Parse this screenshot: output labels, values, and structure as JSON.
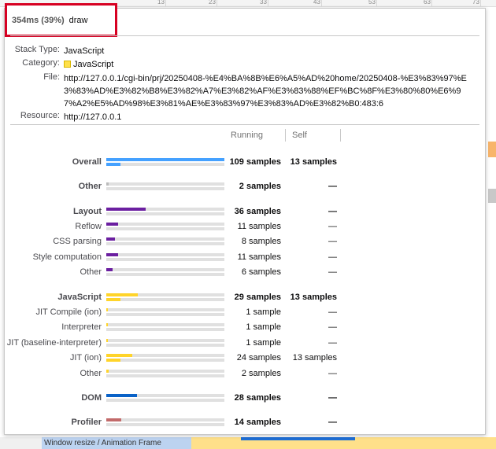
{
  "background": {
    "ticks": [
      "13",
      "23",
      "33",
      "43",
      "53",
      "63",
      "73"
    ],
    "bottom_track_label": "Window resize / Animation Frame"
  },
  "tooltip": {
    "duration": "354ms (39%)",
    "function_name": "draw",
    "details": {
      "stack_type_label": "Stack Type:",
      "stack_type": "JavaScript",
      "category_label": "Category:",
      "category": "JavaScript",
      "category_color": "#ffe04a",
      "file_label": "File:",
      "file": "http://127.0.0.1/cgi-bin/prj/20250408-%E4%BA%8B%E6%A5%AD%20home/20250408-%E3%83%97%E3%83%AD%E3%82%B8%E3%82%A7%E3%82%AF%E3%83%88%EF%BC%8F%E3%80%80%E6%97%A2%E5%AD%98%E3%81%AE%E3%83%97%E3%83%AD%E3%82%B0:483:6",
      "resource_label": "Resource:",
      "resource": "http://127.0.0.1"
    },
    "columns": {
      "running": "Running",
      "self": "Self"
    },
    "categories": [
      {
        "label": "Overall",
        "main": true,
        "running": "109 samples",
        "self": "13 samples",
        "color": "#45a1ff",
        "running_fraction": 1.0,
        "self_fraction": 0.119
      },
      {
        "label": "Other",
        "main": true,
        "running": "2 samples",
        "self": "—",
        "color": "#bbbbbb",
        "running_fraction": 0.018,
        "self_fraction": 0
      },
      {
        "label": "Layout",
        "main": true,
        "running": "36 samples",
        "self": "—",
        "color": "#6b1fa0",
        "running_fraction": 0.33,
        "self_fraction": 0
      },
      {
        "label": "Reflow",
        "main": false,
        "running": "11 samples",
        "self": "—",
        "color": "#6b1fa0",
        "running_fraction": 0.101,
        "self_fraction": 0
      },
      {
        "label": "CSS parsing",
        "main": false,
        "running": "8 samples",
        "self": "—",
        "color": "#6b1fa0",
        "running_fraction": 0.073,
        "self_fraction": 0
      },
      {
        "label": "Style computation",
        "main": false,
        "running": "11 samples",
        "self": "—",
        "color": "#6b1fa0",
        "running_fraction": 0.101,
        "self_fraction": 0
      },
      {
        "label": "Other",
        "main": false,
        "running": "6 samples",
        "self": "—",
        "color": "#6b1fa0",
        "running_fraction": 0.055,
        "self_fraction": 0
      },
      {
        "label": "JavaScript",
        "main": true,
        "running": "29 samples",
        "self": "13 samples",
        "color": "#ffd42a",
        "running_fraction": 0.266,
        "self_fraction": 0.119
      },
      {
        "label": "JIT Compile (ion)",
        "main": false,
        "running": "1 sample",
        "self": "—",
        "color": "#ffd42a",
        "running_fraction": 0.009,
        "self_fraction": 0
      },
      {
        "label": "Interpreter",
        "main": false,
        "running": "1 sample",
        "self": "—",
        "color": "#ffd42a",
        "running_fraction": 0.009,
        "self_fraction": 0
      },
      {
        "label": "JIT (baseline-interpreter)",
        "main": false,
        "running": "1 sample",
        "self": "—",
        "color": "#ffd42a",
        "running_fraction": 0.009,
        "self_fraction": 0
      },
      {
        "label": "JIT (ion)",
        "main": false,
        "running": "24 samples",
        "self": "13 samples",
        "color": "#ffd42a",
        "running_fraction": 0.22,
        "self_fraction": 0.119
      },
      {
        "label": "Other",
        "main": false,
        "running": "2 samples",
        "self": "—",
        "color": "#ffd42a",
        "running_fraction": 0.018,
        "self_fraction": 0
      },
      {
        "label": "DOM",
        "main": true,
        "running": "28 samples",
        "self": "—",
        "color": "#0a62c7",
        "running_fraction": 0.257,
        "self_fraction": 0
      },
      {
        "label": "Profiler",
        "main": true,
        "running": "14 samples",
        "self": "—",
        "color": "#c26a6a",
        "running_fraction": 0.128,
        "self_fraction": 0
      }
    ]
  }
}
